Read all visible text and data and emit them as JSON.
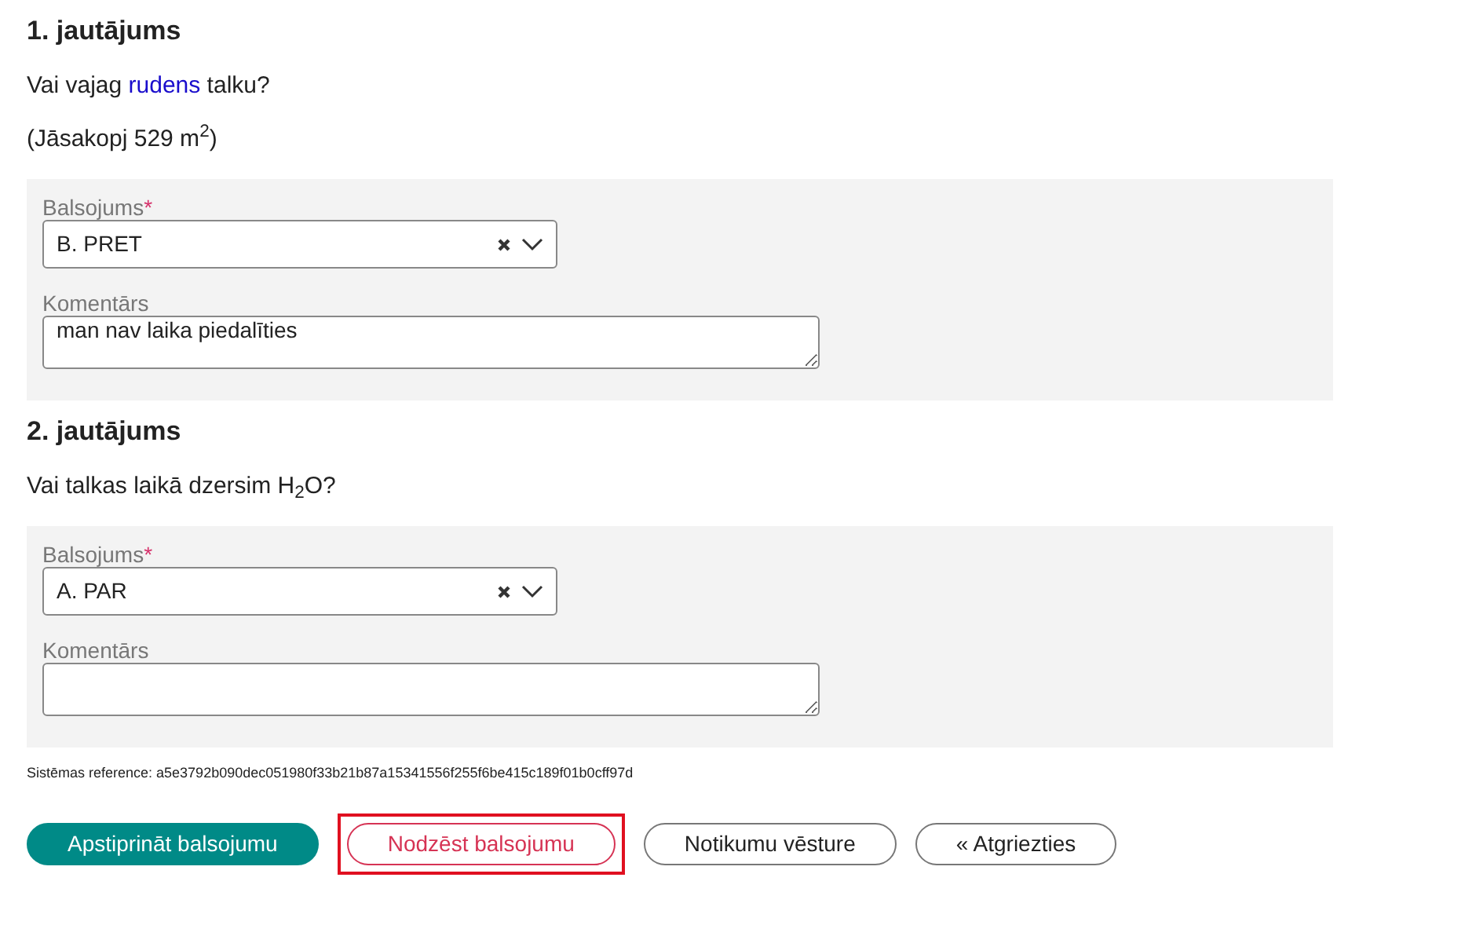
{
  "questions": [
    {
      "title": "1. jautājums",
      "paragraphs": [
        [
          {
            "kind": "text",
            "text": "Vai vajag "
          },
          {
            "kind": "link",
            "text": "rudens"
          },
          {
            "kind": "text",
            "text": " talku?"
          }
        ],
        [
          {
            "kind": "text",
            "text": "(Jāsakopj 529 m$^{2}$)"
          }
        ]
      ],
      "vote": {
        "label": "Balsojums",
        "required": true,
        "required_mark": "*",
        "value": "B. PRET"
      },
      "comment": {
        "label": "Komentārs",
        "value": "man nav laika piedalīties"
      }
    },
    {
      "title": "2. jautājums",
      "paragraphs": [
        [
          {
            "kind": "text",
            "text": "Vai talkas laikā dzersim H$_{2}$O?"
          }
        ]
      ],
      "vote": {
        "label": "Balsojums",
        "required": true,
        "required_mark": "*",
        "value": "A. PAR"
      },
      "comment": {
        "label": "Komentārs"
      }
    }
  ],
  "reference": "Sistēmas reference: a5e3792b090dec051980f33b21b87a15341556f255f6be415c189f01b0cff97d",
  "buttons": [
    {
      "kind": "primary",
      "label": "Apstiprināt balsojumu",
      "highlighted": false
    },
    {
      "kind": "danger",
      "label": "Nodzēst balsojumu",
      "highlighted": true
    },
    {
      "kind": "outline",
      "label": "Notikumu vēsture",
      "highlighted": false
    },
    {
      "kind": "outline",
      "label": "« Atgriezties",
      "highlighted": false
    }
  ]
}
